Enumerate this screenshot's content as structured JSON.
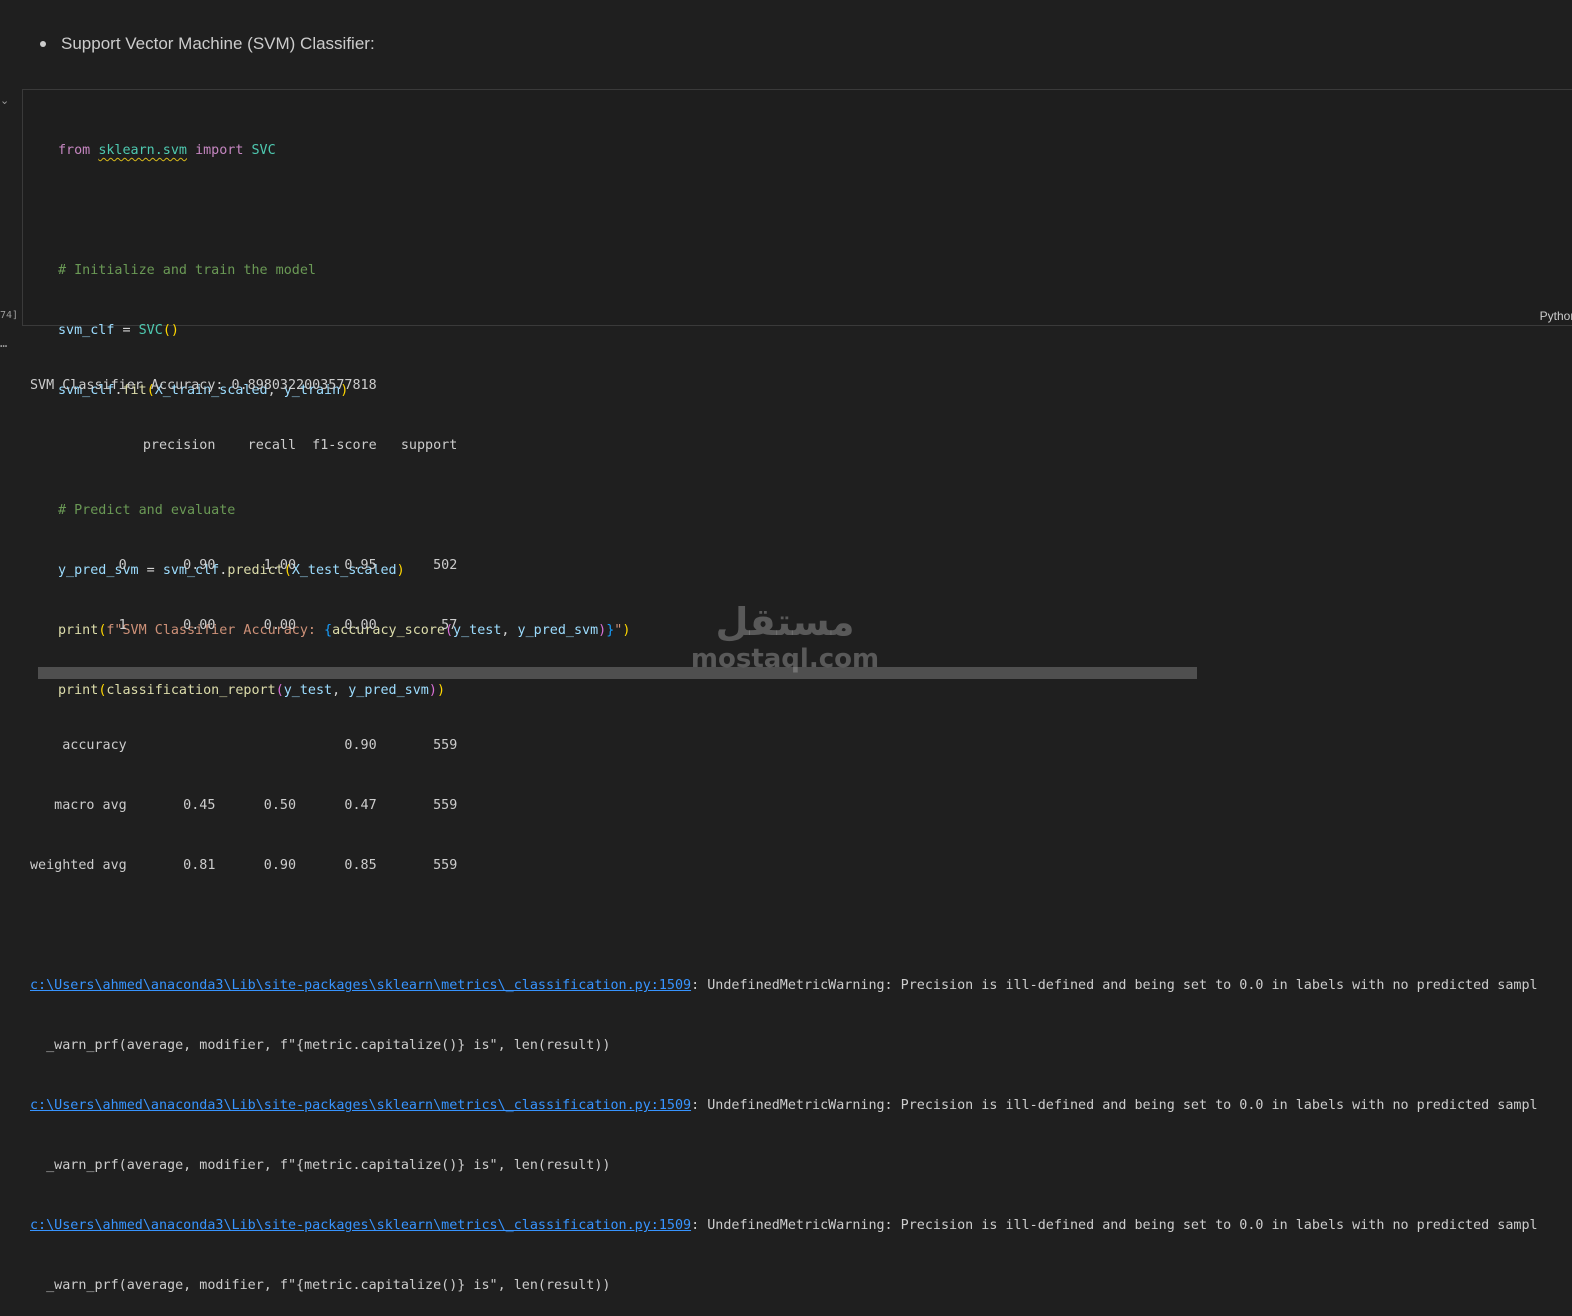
{
  "markdown": {
    "bullet_text": "Support Vector Machine (SVM) Classifier:"
  },
  "cell": {
    "execution_count": "74]",
    "language": "Python",
    "gutter_toggle": "⌄",
    "output_toggle": "…"
  },
  "code": {
    "from_kw": "from",
    "module": "sklearn.svm",
    "import_kw": "import",
    "svc_class": "SVC",
    "comment1": "# Initialize and train the model",
    "svm_clf": "svm_clf",
    "eq": " = ",
    "svc_call": "SVC",
    "fit_obj": "svm_clf",
    "fit_fn": "fit",
    "fit_arg1": "X_train_scaled",
    "fit_arg2": "y_train",
    "comment2": "# Predict and evaluate",
    "y_pred_svm": "y_pred_svm",
    "predict_obj": "svm_clf",
    "predict_fn": "predict",
    "predict_arg": "X_test_scaled",
    "print_fn": "print",
    "fstring_start": "f\"SVM Classifier Accuracy: ",
    "acc_fn": "accuracy_score",
    "acc_arg1": "y_test",
    "acc_arg2": "y_pred_svm",
    "fstring_end": "\"",
    "print2_fn": "print",
    "report_fn": "classification_report",
    "report_arg1": "y_test",
    "report_arg2": "y_pred_svm"
  },
  "output": {
    "lines": [
      "SVM Classifier Accuracy: 0.8980322003577818",
      "              precision    recall  f1-score   support",
      "",
      "           0       0.90      1.00      0.95       502",
      "           1       0.00      0.00      0.00        57",
      "",
      "    accuracy                           0.90       559",
      "   macro avg       0.45      0.50      0.47       559",
      "weighted avg       0.81      0.90      0.85       559",
      ""
    ],
    "warnings": [
      {
        "path": "c:\\Users\\ahmed\\anaconda3\\Lib\\site-packages\\sklearn\\metrics\\_classification.py:1509",
        "message": ": UndefinedMetricWarning: Precision is ill-defined and being set to 0.0 in labels with no predicted sampl",
        "detail": "  _warn_prf(average, modifier, f\"{metric.capitalize()} is\", len(result))"
      },
      {
        "path": "c:\\Users\\ahmed\\anaconda3\\Lib\\site-packages\\sklearn\\metrics\\_classification.py:1509",
        "message": ": UndefinedMetricWarning: Precision is ill-defined and being set to 0.0 in labels with no predicted sampl",
        "detail": "  _warn_prf(average, modifier, f\"{metric.capitalize()} is\", len(result))"
      },
      {
        "path": "c:\\Users\\ahmed\\anaconda3\\Lib\\site-packages\\sklearn\\metrics\\_classification.py:1509",
        "message": ": UndefinedMetricWarning: Precision is ill-defined and being set to 0.0 in labels with no predicted sampl",
        "detail": "  _warn_prf(average, modifier, f\"{metric.capitalize()} is\", len(result))"
      }
    ]
  },
  "watermark": {
    "arabic": "مستقل",
    "latin": "mostaql.com"
  }
}
